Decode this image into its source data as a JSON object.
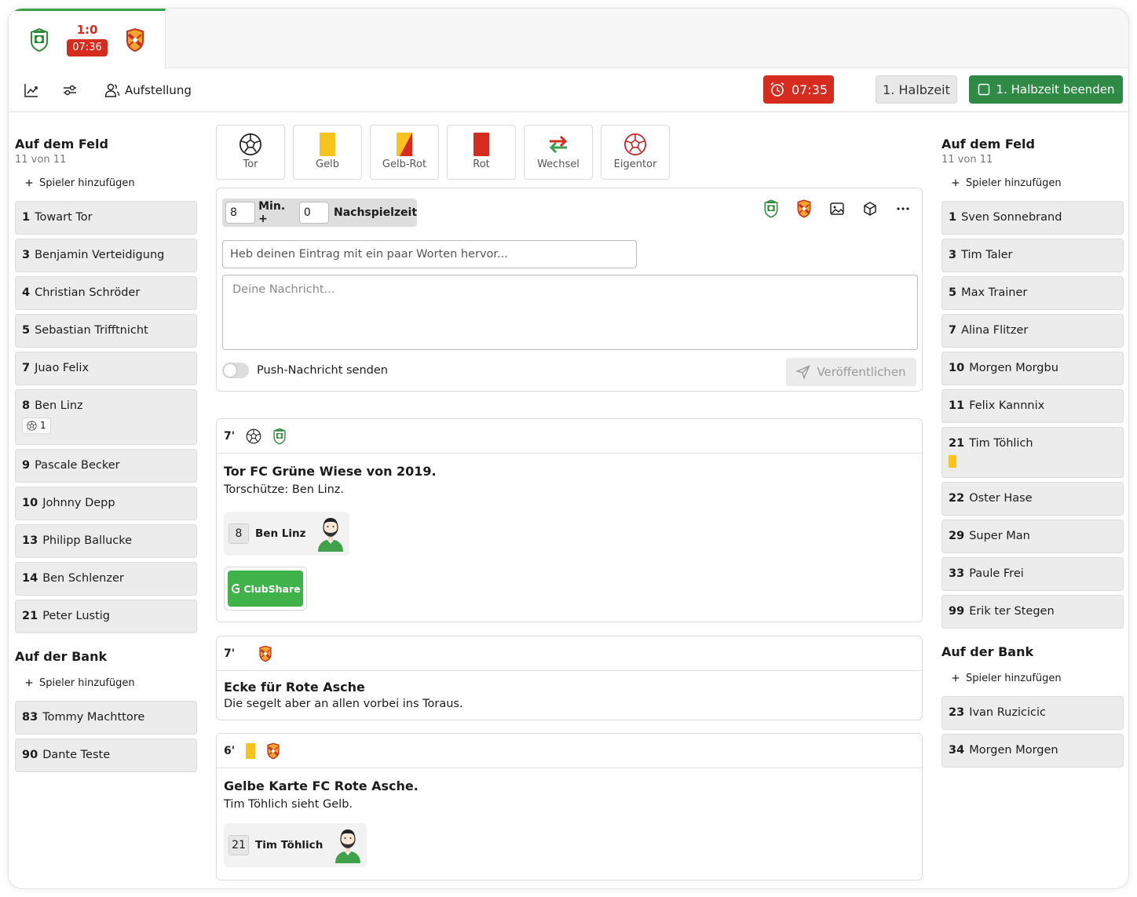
{
  "match": {
    "score": "1:0",
    "time": "07:36"
  },
  "toolbar": {
    "lineup_label": "Aufstellung",
    "clock_label": "07:35",
    "half_label": "1. Halbzeit",
    "end_half_label": "1. Halbzeit beenden"
  },
  "home": {
    "field_title": "Auf dem Feld",
    "field_count": "11 von 11",
    "add_player": "Spieler hinzufügen",
    "field": [
      {
        "num": "1",
        "name": "Towart Tor"
      },
      {
        "num": "3",
        "name": "Benjamin Verteidigung"
      },
      {
        "num": "4",
        "name": "Christian Schröder"
      },
      {
        "num": "5",
        "name": "Sebastian Trifftnicht"
      },
      {
        "num": "7",
        "name": "Juao Felix"
      },
      {
        "num": "8",
        "name": "Ben Linz",
        "goals": "1"
      },
      {
        "num": "9",
        "name": "Pascale Becker"
      },
      {
        "num": "10",
        "name": "Johnny Depp"
      },
      {
        "num": "13",
        "name": "Philipp Ballucke"
      },
      {
        "num": "14",
        "name": "Ben Schlenzer"
      },
      {
        "num": "21",
        "name": "Peter Lustig"
      }
    ],
    "bench_title": "Auf der Bank",
    "bench_add": "Spieler hinzufügen",
    "bench": [
      {
        "num": "83",
        "name": "Tommy Machttore"
      },
      {
        "num": "90",
        "name": "Dante Teste"
      }
    ]
  },
  "away": {
    "field_title": "Auf dem Feld",
    "field_count": "11 von 11",
    "add_player": "Spieler hinzufügen",
    "field": [
      {
        "num": "1",
        "name": "Sven Sonnebrand"
      },
      {
        "num": "3",
        "name": "Tim Taler"
      },
      {
        "num": "5",
        "name": "Max Trainer"
      },
      {
        "num": "7",
        "name": "Alina Flitzer"
      },
      {
        "num": "10",
        "name": "Morgen Morgbu"
      },
      {
        "num": "11",
        "name": "Felix Kannnix"
      },
      {
        "num": "21",
        "name": "Tim Töhlich",
        "card": "yellow"
      },
      {
        "num": "22",
        "name": "Oster Hase"
      },
      {
        "num": "29",
        "name": "Super Man"
      },
      {
        "num": "33",
        "name": "Paule Frei"
      },
      {
        "num": "99",
        "name": "Erik ter Stegen"
      }
    ],
    "bench_title": "Auf der Bank",
    "bench_add": "Spieler hinzufügen",
    "bench": [
      {
        "num": "23",
        "name": "Ivan Ruzicicic"
      },
      {
        "num": "34",
        "name": "Morgen Morgen"
      }
    ]
  },
  "event_types": [
    {
      "label": "Tor",
      "icon": "ball-icon"
    },
    {
      "label": "Gelb",
      "icon": "yellow-card-icon"
    },
    {
      "label": "Gelb-Rot",
      "icon": "yellow-red-card-icon"
    },
    {
      "label": "Rot",
      "icon": "red-card-icon"
    },
    {
      "label": "Wechsel",
      "icon": "substitution-icon"
    },
    {
      "label": "Eigentor",
      "icon": "own-goal-icon"
    }
  ],
  "composer": {
    "minute": "8",
    "min_label": "Min. +",
    "extra": "0",
    "extra_label": "Nachspielzeit",
    "headline_placeholder": "Heb deinen Eintrag mit ein paar Worten hervor...",
    "message_placeholder": "Deine Nachricht...",
    "push_label": "Push-Nachricht senden",
    "publish_label": "Veröffentlichen"
  },
  "events": [
    {
      "minute": "7'",
      "title": "Tor FC Grüne Wiese von 2019.",
      "text": "Torschütze: Ben Linz.",
      "player_num": "8",
      "player_name": "Ben Linz",
      "sponsor": "ClubShare"
    },
    {
      "minute": "7'",
      "title": "Ecke für Rote Asche",
      "text": "Die segelt aber an allen vorbei ins Toraus."
    },
    {
      "minute": "6'",
      "title": "Gelbe Karte FC Rote Asche.",
      "text": "Tim Töhlich sieht Gelb.",
      "player_num": "21",
      "player_name": "Tim Töhlich"
    }
  ],
  "colors": {
    "accent_green": "#2e8a44",
    "alert_red": "#d62b1f",
    "yellow_card": "#f7c31c",
    "red_card": "#d62b1f"
  }
}
